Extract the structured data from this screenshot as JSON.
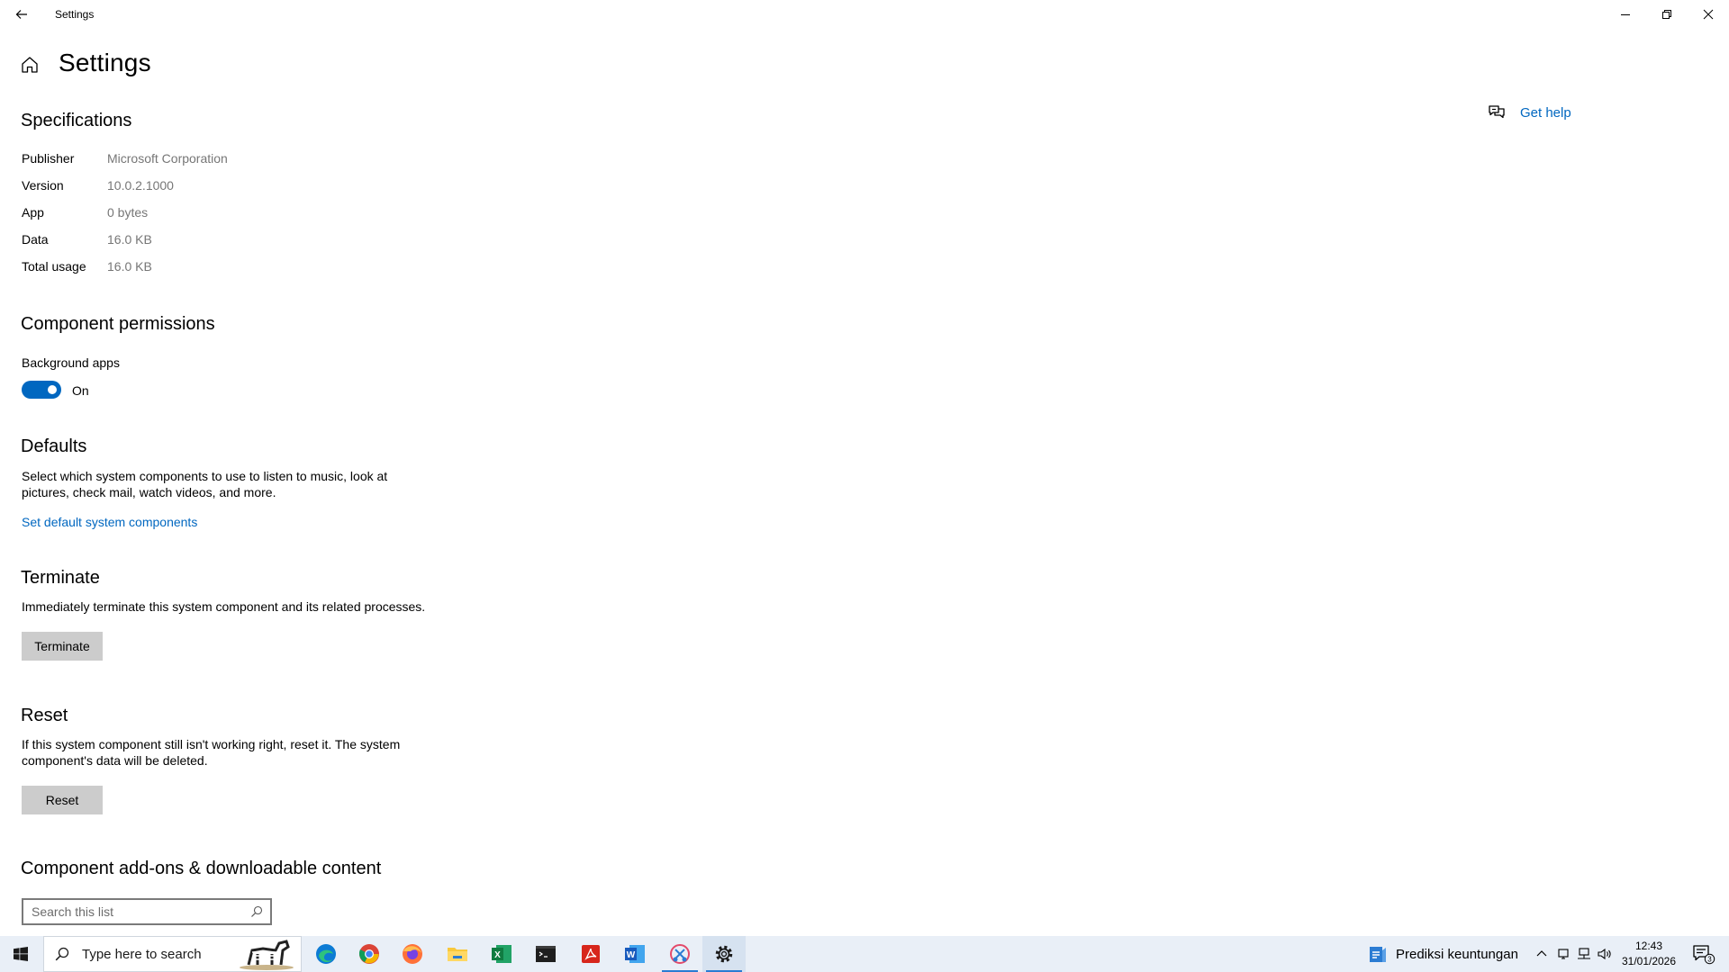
{
  "window": {
    "title": "Settings"
  },
  "page": {
    "title": "Settings"
  },
  "help": {
    "label": "Get help"
  },
  "specifications": {
    "title": "Specifications",
    "rows": [
      {
        "key": "Publisher",
        "value": "Microsoft Corporation"
      },
      {
        "key": "Version",
        "value": "10.0.2.1000"
      },
      {
        "key": "App",
        "value": "0 bytes"
      },
      {
        "key": "Data",
        "value": "16.0 KB"
      },
      {
        "key": "Total usage",
        "value": "16.0 KB"
      }
    ]
  },
  "permissions": {
    "title": "Component permissions",
    "background_label": "Background apps",
    "background_state": "On",
    "background_enabled": true
  },
  "defaults": {
    "title": "Defaults",
    "description": "Select which system components to use to listen to music, look at pictures, check mail, watch videos, and more.",
    "link": "Set default system components"
  },
  "terminate": {
    "title": "Terminate",
    "description": "Immediately terminate this system component and its related processes.",
    "button": "Terminate"
  },
  "reset": {
    "title": "Reset",
    "description": "If this system component still isn't working right, reset it. The system component's data will be deleted.",
    "button": "Reset"
  },
  "addons": {
    "title": "Component add-ons & downloadable content",
    "search_placeholder": "Search this list"
  },
  "taskbar": {
    "search_text": "Type here to search",
    "widget_label": "Prediksi keuntungan",
    "time": "12:43",
    "date": "31/01/2026",
    "notification_count": "3",
    "apps": [
      "edge-icon",
      "chrome-icon",
      "firefox-icon",
      "file-explorer-icon",
      "excel-icon",
      "terminal-icon",
      "acrobat-icon",
      "word-icon",
      "snipping-tool-icon",
      "settings-icon"
    ]
  },
  "colors": {
    "accent": "#0067c0",
    "taskbar": "#e9eff7",
    "button": "#cccccc"
  }
}
